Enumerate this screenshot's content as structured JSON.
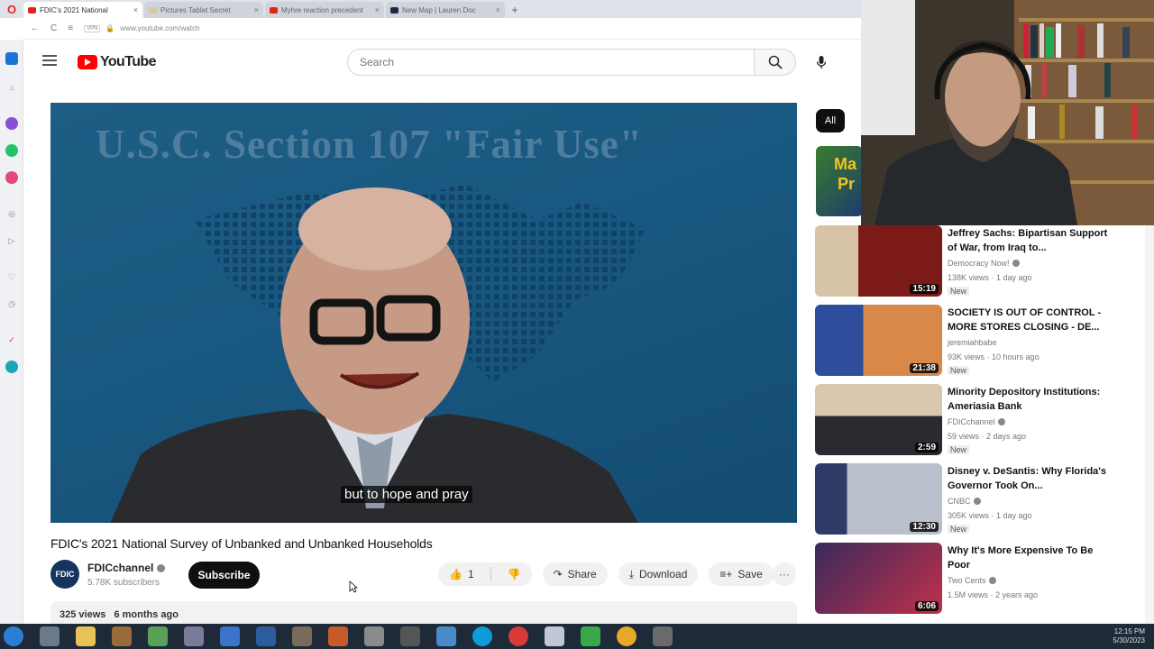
{
  "browser": {
    "tabs": [
      {
        "label": "FDIC's 2021 National",
        "color": "#e62117",
        "active": true
      },
      {
        "label": "Pictures Tablet Secret",
        "color": "#d6c8a0",
        "active": false
      },
      {
        "label": "Myhre reaction precedent",
        "color": "#e62117",
        "active": false
      },
      {
        "label": "New Map | Lauren Doc",
        "color": "#1a2a44",
        "active": false
      }
    ],
    "new_tab": "+",
    "address": "www.youtube.com/watch",
    "nav": {
      "back": "←",
      "forward": "→",
      "reload": "C"
    }
  },
  "youtube": {
    "logo_text": "YouTube",
    "search_placeholder": "Search",
    "video": {
      "overlay_title": "U.S.C. Section 107 \"Fair Use\"",
      "caption": "but to hope and pray",
      "title": "FDIC's 2021 National Survey of Unbanked and Unbanked Households",
      "channel": "FDICchannel",
      "channel_avatar": "FDIC",
      "subscribers": "5.78K subscribers",
      "subscribe_label": "Subscribe",
      "likes": "1",
      "share_label": "Share",
      "download_label": "Download",
      "save_label": "Save",
      "views": "325 views",
      "age": "6 months ago"
    },
    "chips": {
      "all": "All"
    },
    "related_partial": {
      "line1": "Ma",
      "line2": "Pr"
    },
    "recommendations": [
      {
        "title": "Jeffrey Sachs: Bipartisan Support of War, from Iraq to...",
        "channel": "Democracy Now!",
        "views": "138K views",
        "age": "1 day ago",
        "duration": "15:19",
        "badge": "New",
        "thumb_color": "#7c1a18"
      },
      {
        "title": "SOCIETY IS OUT OF CONTROL - MORE STORES CLOSING - DE...",
        "channel": "jeremiahbabe",
        "views": "93K views",
        "age": "10 hours ago",
        "duration": "21:38",
        "badge": "New",
        "thumb_color": "#2e4d9a"
      },
      {
        "title": "Minority Depository Institutions: Ameriasia Bank",
        "channel": "FDICchannel",
        "views": "59 views",
        "age": "2 days ago",
        "duration": "2:59",
        "badge": "New",
        "thumb_color": "#cdb8a0"
      },
      {
        "title": "Disney v. DeSantis: Why Florida's Governor Took On...",
        "channel": "CNBC",
        "views": "305K views",
        "age": "1 day ago",
        "duration": "12:30",
        "badge": "New",
        "thumb_color": "#2d3b66"
      },
      {
        "title": "Why It's More Expensive To Be Poor",
        "channel": "Two Cents",
        "views": "1.5M views",
        "age": "2 years ago",
        "duration": "6:06",
        "badge": "",
        "thumb_color": "#3a2a5c"
      }
    ]
  },
  "taskbar": {
    "time": "12:15 PM",
    "date": "5/30/2023"
  },
  "colors": {
    "yt_red": "#ff0000",
    "player_blue": "#18577f",
    "taskbar": "#1e2a38"
  }
}
